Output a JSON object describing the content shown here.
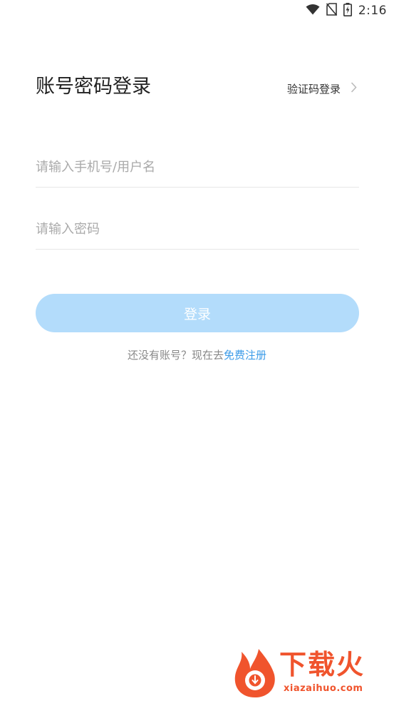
{
  "status_bar": {
    "time": "2:16",
    "icons": [
      "wifi-icon",
      "no-sim-icon",
      "battery-charging-icon"
    ]
  },
  "header": {
    "title": "账号密码登录",
    "switch_label": "验证码登录",
    "switch_icon": "chevron-right-icon"
  },
  "form": {
    "account_placeholder": "请输入手机号/用户名",
    "account_value": "",
    "password_placeholder": "请输入密码",
    "password_value": "",
    "login_label": "登录"
  },
  "register": {
    "prompt": "还没有账号？现在去",
    "link": "免费注册"
  },
  "watermark": {
    "brand": "下载火",
    "url": "xiazaihuo.com"
  },
  "colors": {
    "primary_light": "#b3dcfb",
    "link": "#3b9be8",
    "watermark": "#f0542d"
  }
}
